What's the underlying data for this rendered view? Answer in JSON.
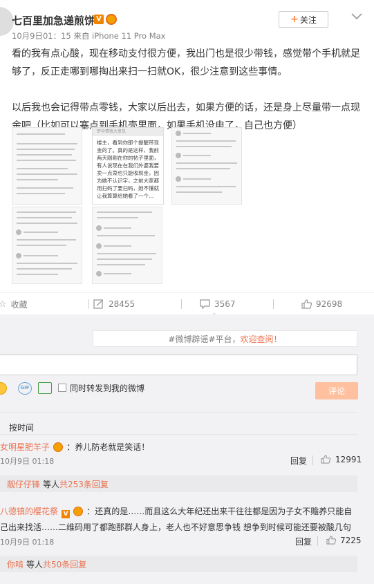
{
  "post": {
    "author": "七百里加急递煎饼",
    "meta": "10月9日01：15 来自 iPhone 11 Pro Max",
    "follow_label": "关注",
    "paragraph1": "看的我有点心酸，现在移动支付很方便，我出门也是很少带钱，感觉带个手机就足够了，反正走哪到哪掏出来扫一扫就OK，很少注意到这些事情。",
    "paragraph2": "以后我也会记得带点零钱，大家以后出去，如果方便的话，还是身上尽量带一点现金吧（比如可以塞点到手机壳里面，如果手机没电了，自己也方便）",
    "image_caption_center": "楼主，看到你那个提醒带现金的了。真的是这样，我前两天刚刚在你的帖子里面，有人说现在在我们外婆我要卖一点菜也只能收现金，因为她不认识字，之前大家都用扫码了要扫码，她不懂就让我算算给她看了一个..."
  },
  "actions": {
    "favorite": "收藏",
    "repost_count": "28455",
    "comment_count": "3567",
    "like_count": "92698"
  },
  "composer": {
    "notice_prefix": "#微博辟谣#平台，",
    "notice_link": "欢迎查阅！",
    "repost_checkbox_label": "同时转发到我的微博",
    "submit_label": "评论"
  },
  "comments": {
    "sort_label": "按时间",
    "items": [
      {
        "user": "女明星肥羊子",
        "text": "：养儿防老就是笑话！",
        "time": "10月9日 01:18",
        "reply_label": "回复",
        "likes": "12991",
        "reply_user": "靓仔仔锋",
        "reply_mid": "等人",
        "reply_count": "共253条回复"
      },
      {
        "user": "八德镇的樱花祭",
        "text": "：还真的是……而且这么大年纪还出来干往往都是因为子女不赡养只能自己出来找活……二维码用了都跑那群人身上，老人也不好意思争钱 想争到时候可能还要被酸几句",
        "time": "10月9日 01:18",
        "reply_label": "回复",
        "likes": "7225",
        "reply_user": "你啃",
        "reply_mid": "等人",
        "reply_count": "共50条回复"
      }
    ]
  }
}
